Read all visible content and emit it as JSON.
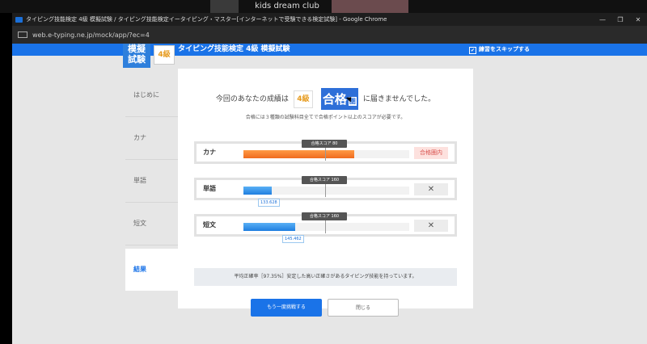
{
  "meeting": {
    "participant_name": "kids dream club"
  },
  "window": {
    "title": "タイピング技能検定 4級 模擬試験 / タイピング技能検定イータイピング・マスター[インターネットで受験できる検定試験] - Google Chrome",
    "url": "web.e-typing.ne.jp/mock/app/?ec=4"
  },
  "header": {
    "logo_line1": "模擬",
    "logo_line2": "試験",
    "grade": "4級",
    "title": "タイピング技能検定 4級 模擬試験",
    "skip_label": "練習をスキップする"
  },
  "steps": [
    "はじめに",
    "カナ",
    "単語",
    "短文",
    "結果"
  ],
  "result": {
    "prefix": "今回のあなたの成績は",
    "grade": "4級",
    "pass_label": "合格",
    "pass_sub": "圏",
    "suffix": "に届きませんでした。",
    "note": "合格には３種類の試験科目全てで合格ポイント以上のスコアが必要です。"
  },
  "scores": [
    {
      "label": "カナ",
      "pass_score": "合格スコア 80",
      "progress": 0.67,
      "value": "",
      "status": "合格圏内",
      "status_type": "pass",
      "color": "orange"
    },
    {
      "label": "単語",
      "pass_score": "合格スコア 160",
      "progress": 0.17,
      "value": "133.628",
      "status": "✕",
      "status_type": "fail",
      "color": "blue"
    },
    {
      "label": "短文",
      "pass_score": "合格スコア 160",
      "progress": 0.31,
      "value": "145.462",
      "status": "✕",
      "status_type": "fail",
      "color": "blue"
    }
  ],
  "summary": "平均正確率［97.35%］安定した高い正確さがあるタイピング技能を持っています。",
  "buttons": {
    "retry": "もう一度挑戦する",
    "close": "閉じる"
  }
}
